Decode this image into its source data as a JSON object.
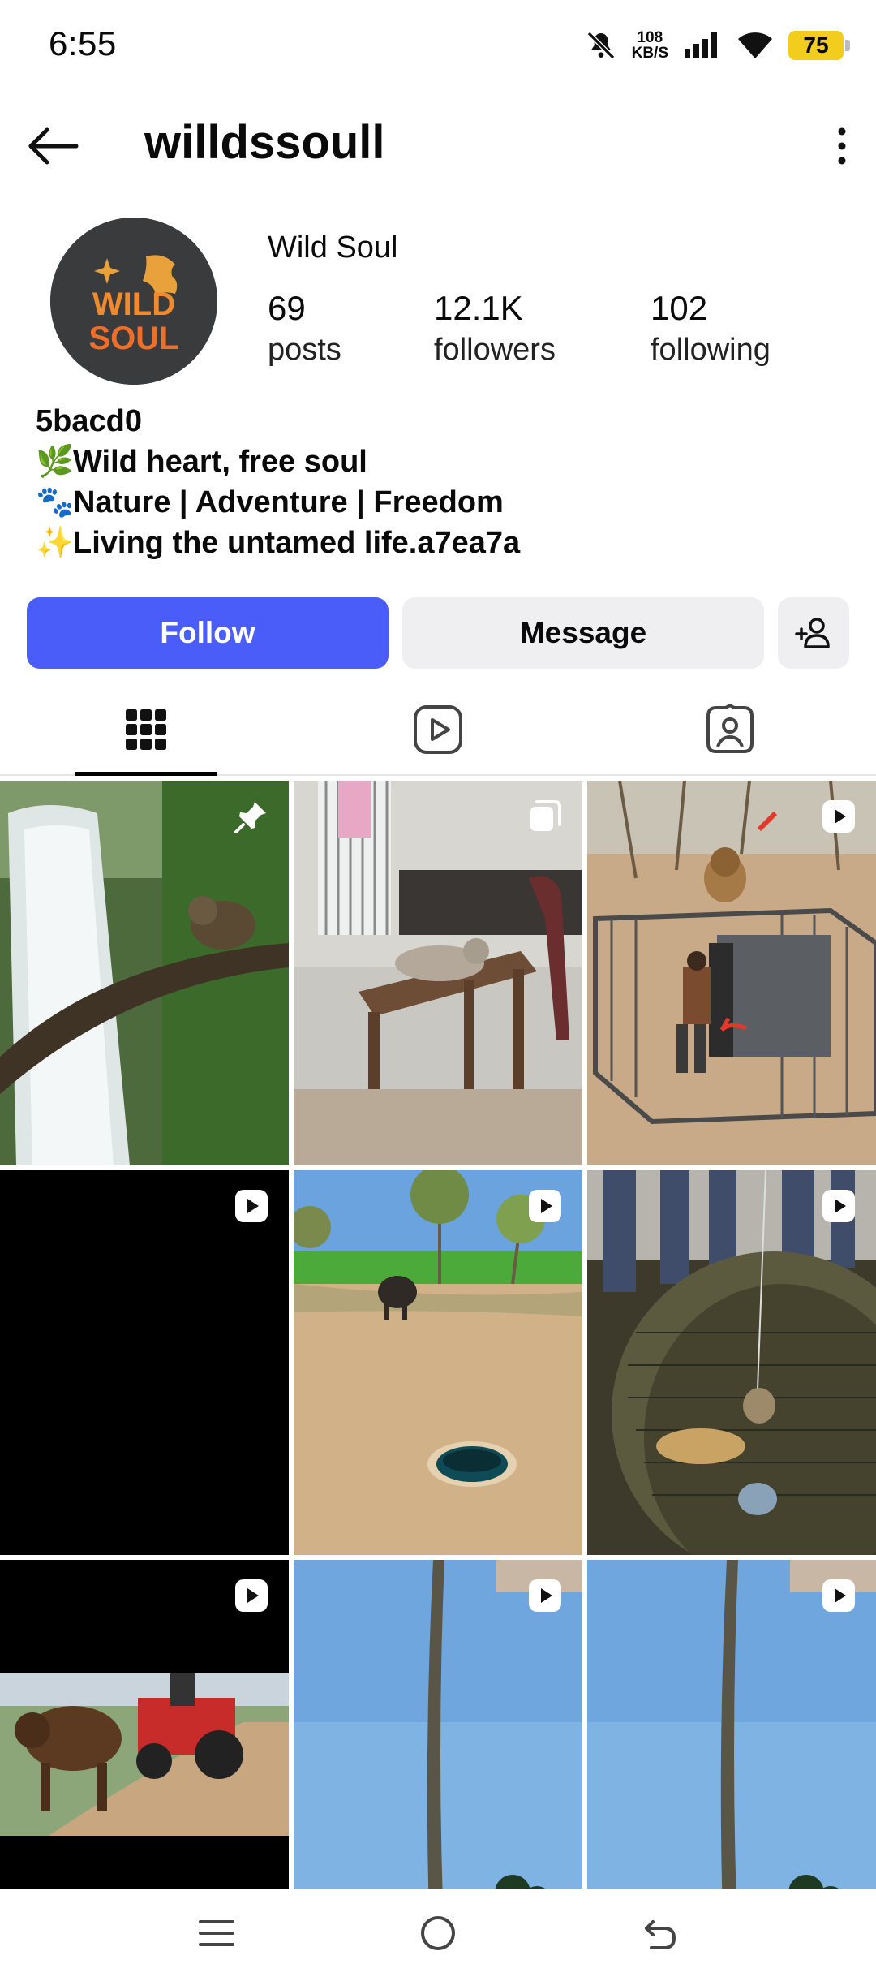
{
  "status": {
    "time": "6:55",
    "net_speed_value": "108",
    "net_speed_unit": "KB/S",
    "battery": "75"
  },
  "header": {
    "username": "willdssoull"
  },
  "profile": {
    "avatar_text_top": "WILD",
    "avatar_text_bottom": "SOUL",
    "display_name": "Wild Soul",
    "stats": [
      {
        "value": "69",
        "label": "posts"
      },
      {
        "value": "12.1K",
        "label": "followers"
      },
      {
        "value": "102",
        "label": "following"
      }
    ],
    "bio": [
      {
        "emoji": "",
        "text": "5bacd0"
      },
      {
        "emoji": "🌿",
        "text": "Wild heart, free soul"
      },
      {
        "emoji": "🐾",
        "text": "Nature | Adventure | Freedom"
      },
      {
        "emoji": "✨",
        "text": "Living the untamed life.a7ea7a"
      }
    ]
  },
  "actions": {
    "follow_label": "Follow",
    "message_label": "Message"
  },
  "tabs": [
    {
      "name": "posts-grid-tab",
      "icon": "grid-icon",
      "selected": true
    },
    {
      "name": "reels-tab",
      "icon": "reels-icon",
      "selected": false
    },
    {
      "name": "tagged-tab",
      "icon": "tagged-icon",
      "selected": false
    }
  ],
  "posts": [
    {
      "subject": "waterfall monkey",
      "badge": "pin-icon"
    },
    {
      "subject": "cat on table",
      "badge": "carousel-icon"
    },
    {
      "subject": "lion cage",
      "badge": "reel-icon"
    },
    {
      "subject": "black",
      "badge": "reel-icon"
    },
    {
      "subject": "buffalo hole",
      "badge": "reel-icon"
    },
    {
      "subject": "leopard well",
      "badge": "reel-icon"
    },
    {
      "subject": "bull tractor",
      "badge": "reel-icon"
    },
    {
      "subject": "palm tree",
      "badge": "reel-icon"
    },
    {
      "subject": "palm tree 2",
      "badge": "reel-icon"
    }
  ],
  "colors": {
    "follow": "#4a5df9",
    "secondary_button": "#efeff1",
    "battery": "#f2cd1e"
  }
}
